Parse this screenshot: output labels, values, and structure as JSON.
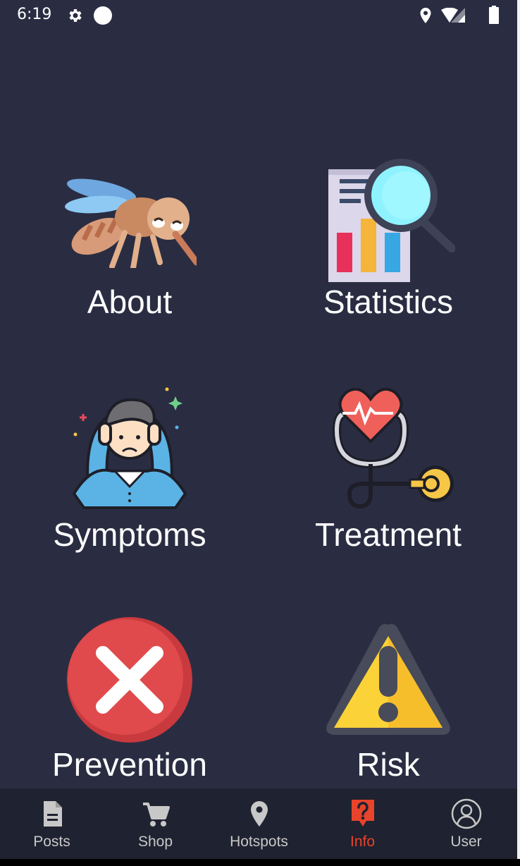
{
  "status_bar": {
    "time": "6:19",
    "icons": [
      "gear-icon",
      "circle-icon",
      "location-icon",
      "wifi-icon",
      "signal-icon",
      "battery-icon"
    ]
  },
  "tiles": [
    {
      "label": "About",
      "icon": "mosquito-icon"
    },
    {
      "label": "Statistics",
      "icon": "statistics-report-icon"
    },
    {
      "label": "Symptoms",
      "icon": "distressed-person-icon"
    },
    {
      "label": "Treatment",
      "icon": "stethoscope-heart-icon"
    },
    {
      "label": "Prevention",
      "icon": "red-x-icon"
    },
    {
      "label": "Risk",
      "icon": "warning-triangle-icon"
    }
  ],
  "bottom_nav": {
    "active": "Info",
    "active_color": "#e8432b",
    "items": [
      {
        "label": "Posts",
        "icon": "document-icon"
      },
      {
        "label": "Shop",
        "icon": "cart-icon"
      },
      {
        "label": "Hotspots",
        "icon": "location-pin-icon"
      },
      {
        "label": "Info",
        "icon": "question-icon"
      },
      {
        "label": "User",
        "icon": "user-icon"
      }
    ]
  },
  "colors": {
    "background": "#2a2d42",
    "nav_background": "#1f2230"
  }
}
